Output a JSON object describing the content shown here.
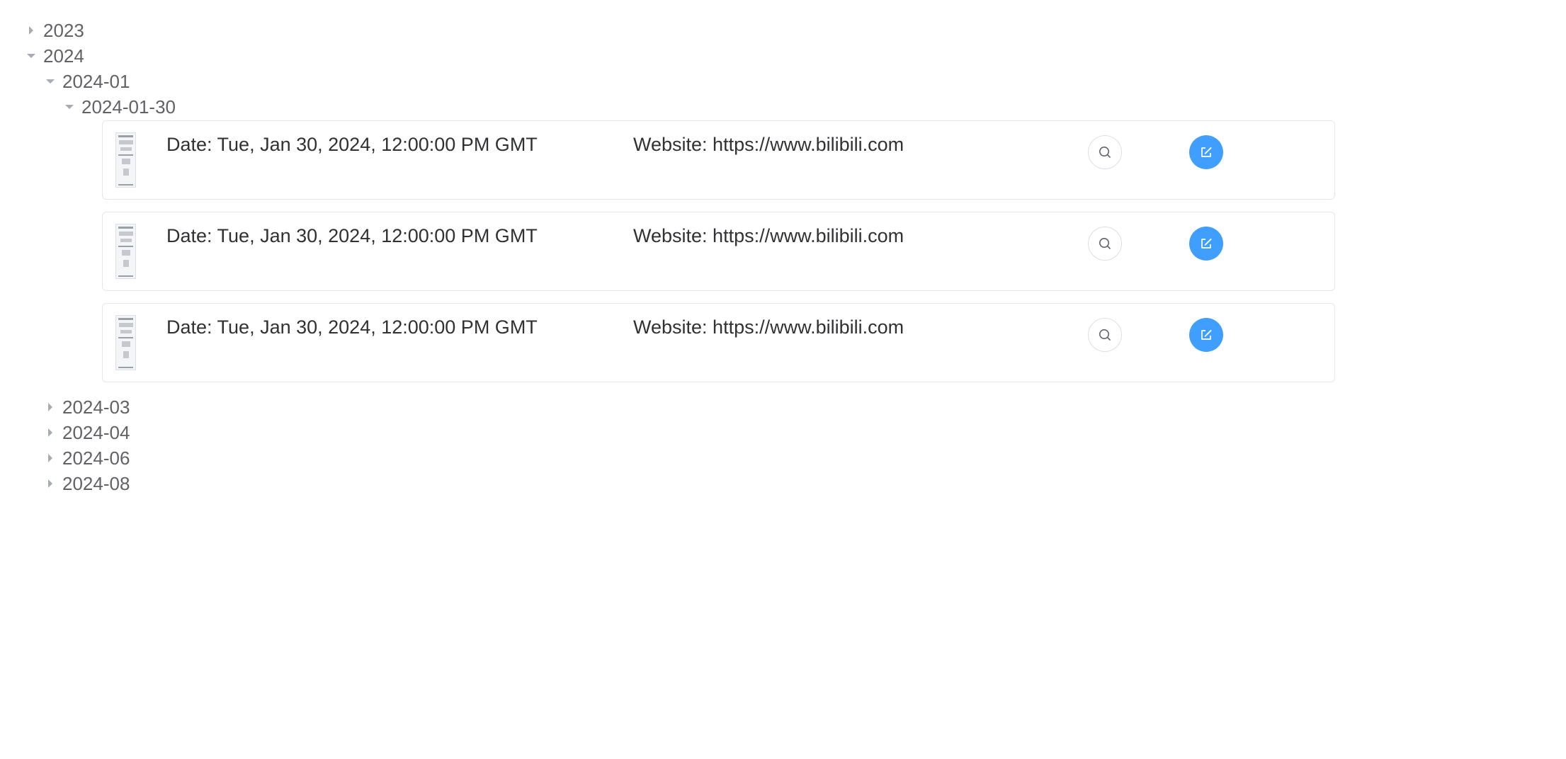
{
  "tree": {
    "year_2023": {
      "label": "2023",
      "expanded": false
    },
    "year_2024": {
      "label": "2024",
      "expanded": true
    },
    "month_2024_01": {
      "label": "2024-01",
      "expanded": true
    },
    "day_2024_01_30": {
      "label": "2024-01-30",
      "expanded": true
    },
    "month_2024_03": {
      "label": "2024-03",
      "expanded": false
    },
    "month_2024_04": {
      "label": "2024-04",
      "expanded": false
    },
    "month_2024_06": {
      "label": "2024-06",
      "expanded": false
    },
    "month_2024_08": {
      "label": "2024-08",
      "expanded": false
    }
  },
  "records": [
    {
      "date": "Date: Tue, Jan 30, 2024, 12:00:00 PM GMT",
      "website": "Website: https://www.bilibili.com"
    },
    {
      "date": "Date: Tue, Jan 30, 2024, 12:00:00 PM GMT",
      "website": "Website: https://www.bilibili.com"
    },
    {
      "date": "Date: Tue, Jan 30, 2024, 12:00:00 PM GMT",
      "website": "Website: https://www.bilibili.com"
    }
  ],
  "icons": {
    "view": "search-icon",
    "edit": "edit-icon",
    "expand": "caret-right-icon",
    "collapse": "caret-down-icon"
  },
  "colors": {
    "primary": "#409eff",
    "text": "#606266",
    "border": "#e4e7ed"
  }
}
